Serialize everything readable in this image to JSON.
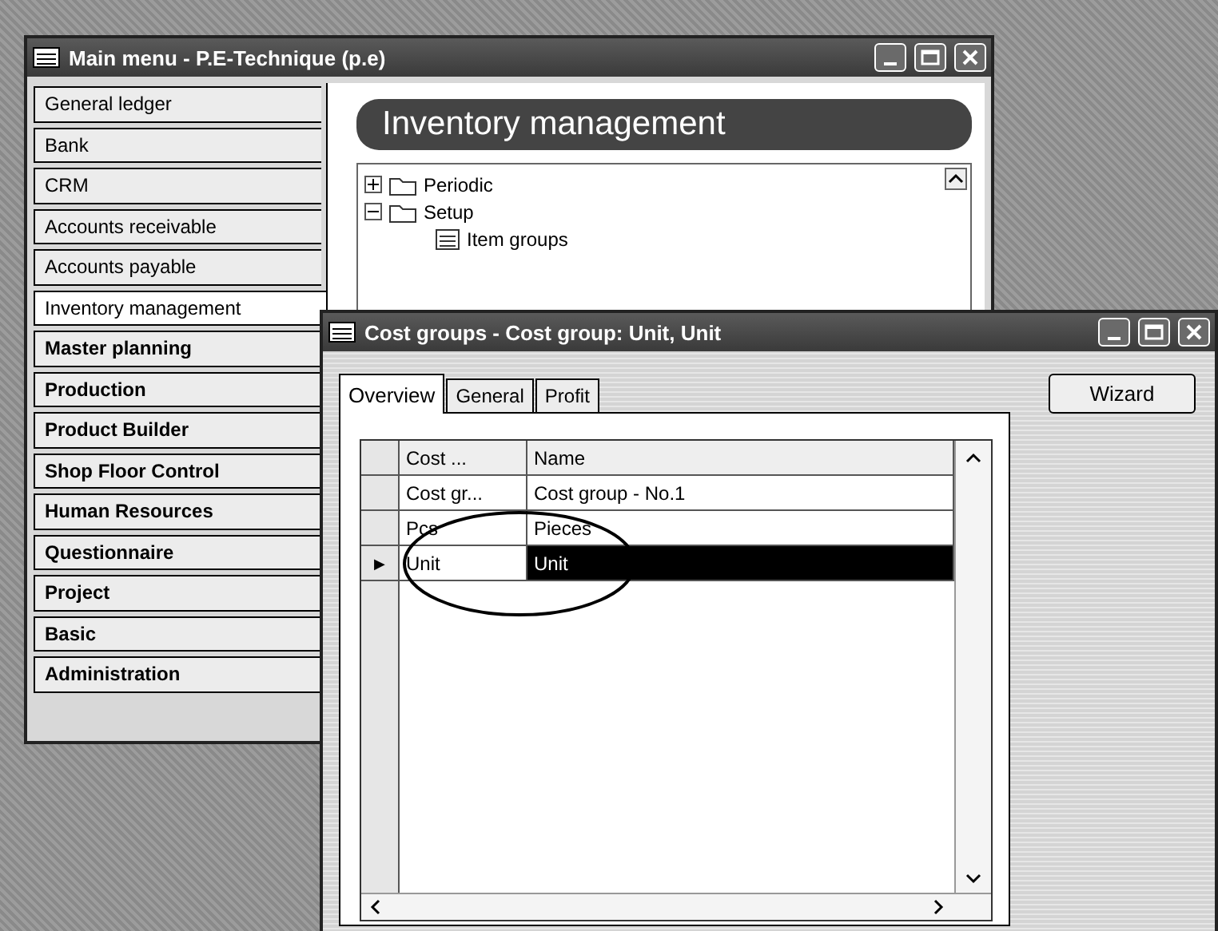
{
  "main_window": {
    "title": "Main menu - P.E-Technique (p.e)",
    "modules": [
      {
        "label": "General ledger",
        "selected": false
      },
      {
        "label": "Bank",
        "selected": false
      },
      {
        "label": "CRM",
        "selected": false
      },
      {
        "label": "Accounts receivable",
        "selected": false
      },
      {
        "label": "Accounts payable",
        "selected": false
      },
      {
        "label": "Inventory management",
        "selected": true
      },
      {
        "label": "Master planning",
        "selected": false
      },
      {
        "label": "Production",
        "selected": false
      },
      {
        "label": "Product Builder",
        "selected": false
      },
      {
        "label": "Shop Floor Control",
        "selected": false
      },
      {
        "label": "Human Resources",
        "selected": false
      },
      {
        "label": "Questionnaire",
        "selected": false
      },
      {
        "label": "Project",
        "selected": false
      },
      {
        "label": "Basic",
        "selected": false
      },
      {
        "label": "Administration",
        "selected": false
      }
    ],
    "header": "Inventory management",
    "tree": [
      {
        "label": "Periodic",
        "kind": "folder",
        "expanded": false
      },
      {
        "label": "Setup",
        "kind": "folder",
        "expanded": true,
        "children": [
          {
            "label": "Item groups",
            "kind": "form"
          }
        ]
      }
    ]
  },
  "dialog": {
    "title": "Cost groups - Cost group: Unit, Unit",
    "tabs": [
      {
        "label": "Overview",
        "selected": true
      },
      {
        "label": "General",
        "selected": false
      },
      {
        "label": "Profit",
        "selected": false
      }
    ],
    "wizard_button": "Wizard",
    "table": {
      "columns": [
        "Cost ...",
        "Name"
      ],
      "rows": [
        {
          "cells": [
            "Cost gr...",
            "Cost group - No.1"
          ],
          "selected": false
        },
        {
          "cells": [
            "Pcs",
            "Pieces"
          ],
          "selected": false
        },
        {
          "cells": [
            "Unit",
            "Unit"
          ],
          "selected": true
        }
      ]
    },
    "row_marker": "▶"
  }
}
